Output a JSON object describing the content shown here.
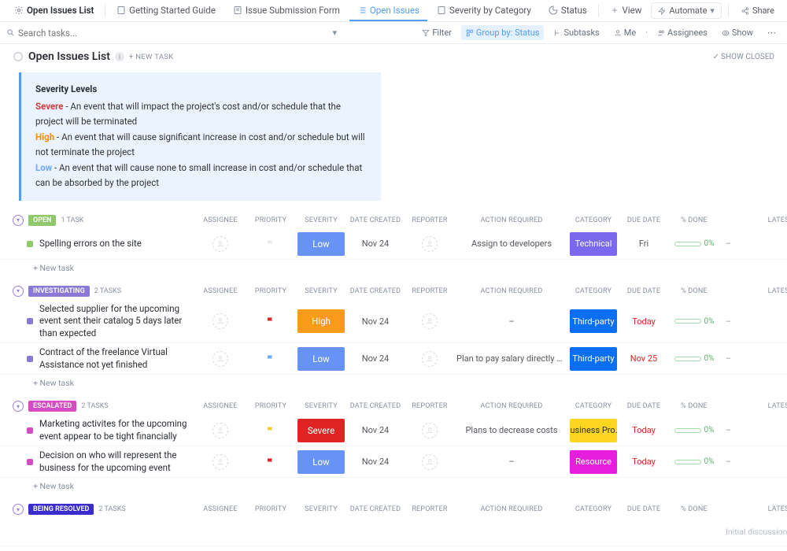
{
  "tabs": [
    {
      "label": "Open Issues List",
      "icon": "gear"
    },
    {
      "label": "Getting Started Guide",
      "icon": "doc"
    },
    {
      "label": "Issue Submission Form",
      "icon": "form"
    },
    {
      "label": "Open Issues",
      "icon": "list",
      "active": true
    },
    {
      "label": "Severity by Category",
      "icon": "doc"
    },
    {
      "label": "Status",
      "icon": "pie"
    },
    {
      "label": "View",
      "icon": "plus"
    }
  ],
  "topbar": {
    "automate": "Automate",
    "share": "Share"
  },
  "toolbar": {
    "search_placeholder": "Search tasks...",
    "filter": "Filter",
    "group_by": "Group by: Status",
    "subtasks": "Subtasks",
    "me": "Me",
    "assignees": "Assignees",
    "show": "Show"
  },
  "page": {
    "title": "Open Issues List",
    "new_task": "+ NEW TASK",
    "show_closed": "SHOW CLOSED"
  },
  "alert": {
    "title": "Severity Levels",
    "severe": "Severe",
    "severe_desc": " - An event that will impact the project's cost and/or schedule that the project will be terminated",
    "high": "High",
    "high_desc": " - An event that will cause significant increase in cost and/or schedule but will not terminate the project",
    "low": "Low",
    "low_desc": " - An event that will cause none to small increase in cost and/or schedule that can be absorbed by the project"
  },
  "columns": {
    "assignee": "ASSIGNEE",
    "priority": "PRIORITY",
    "severity": "SEVERITY",
    "date_created": "DATE CREATED",
    "reporter": "REPORTER",
    "action_required": "ACTION REQUIRED",
    "category": "CATEGORY",
    "due_date": "DUE DATE",
    "pct_done": "% DONE",
    "latest_comment": "LATEST COMMENT"
  },
  "groups": [
    {
      "status": "OPEN",
      "status_class": "chip-open",
      "sq": "green",
      "count": "1 TASK",
      "tasks": [
        {
          "name": "Spelling errors on the site",
          "flag": "",
          "severity": "Low",
          "sev_class": "sev-low",
          "date": "Nov 24",
          "action": "Assign to developers",
          "category": "Technical",
          "cat_class": "cat-tech",
          "due": "Fri",
          "due_class": "due-normal",
          "pct": "0%",
          "comment": "–"
        }
      ],
      "show_new": true
    },
    {
      "status": "INVESTIGATING",
      "status_class": "chip-invest",
      "sq": "purple",
      "count": "2 TASKS",
      "tasks": [
        {
          "name": "Selected supplier for the upcoming event sent their catalog 5 days later than expected",
          "flag": "#e02424",
          "severity": "High",
          "sev_class": "sev-high",
          "date": "Nov 24",
          "action": "–",
          "category": "Third-party",
          "cat_class": "cat-third",
          "due": "Today",
          "due_class": "due-red",
          "pct": "0%",
          "comment": "–"
        },
        {
          "name": "Contract of the freelance Virtual Assistance not yet finished",
          "flag": "#6fa8ff",
          "severity": "Low",
          "sev_class": "sev-low",
          "date": "Nov 24",
          "action": "Plan to pay salary directly so he can start already",
          "category": "Third-party",
          "cat_class": "cat-third",
          "due": "Nov 25",
          "due_class": "due-red",
          "pct": "0%",
          "comment": "–"
        }
      ],
      "show_new": true
    },
    {
      "status": "ESCALATED",
      "status_class": "chip-esc",
      "sq": "pink",
      "count": "2 TASKS",
      "tasks": [
        {
          "name": "Marketing activites for the upcoming event appear to be tight financially",
          "flag": "#f8c834",
          "severity": "Severe",
          "sev_class": "sev-severe",
          "date": "Nov 24",
          "action": "Plans to decrease costs",
          "category": "Business Pro...",
          "cat_class": "cat-biz",
          "due": "Today",
          "due_class": "due-red",
          "pct": "0%",
          "comment": "–"
        },
        {
          "name": "Decision on who will represent the business for the upcoming event",
          "flag": "#e02424",
          "severity": "Low",
          "sev_class": "sev-low",
          "date": "Nov 24",
          "action": "–",
          "category": "Resource",
          "cat_class": "cat-res",
          "due": "Today",
          "due_class": "due-red",
          "pct": "0%",
          "comment": "–"
        }
      ],
      "show_new": true
    },
    {
      "status": "BEING RESOLVED",
      "status_class": "chip-resolve",
      "sq": "",
      "count": "2 TASKS",
      "tasks": [],
      "show_new": false,
      "trailing_comment": "Initial discussion last meeting. To finalize"
    }
  ],
  "new_task_label": "+ New task"
}
